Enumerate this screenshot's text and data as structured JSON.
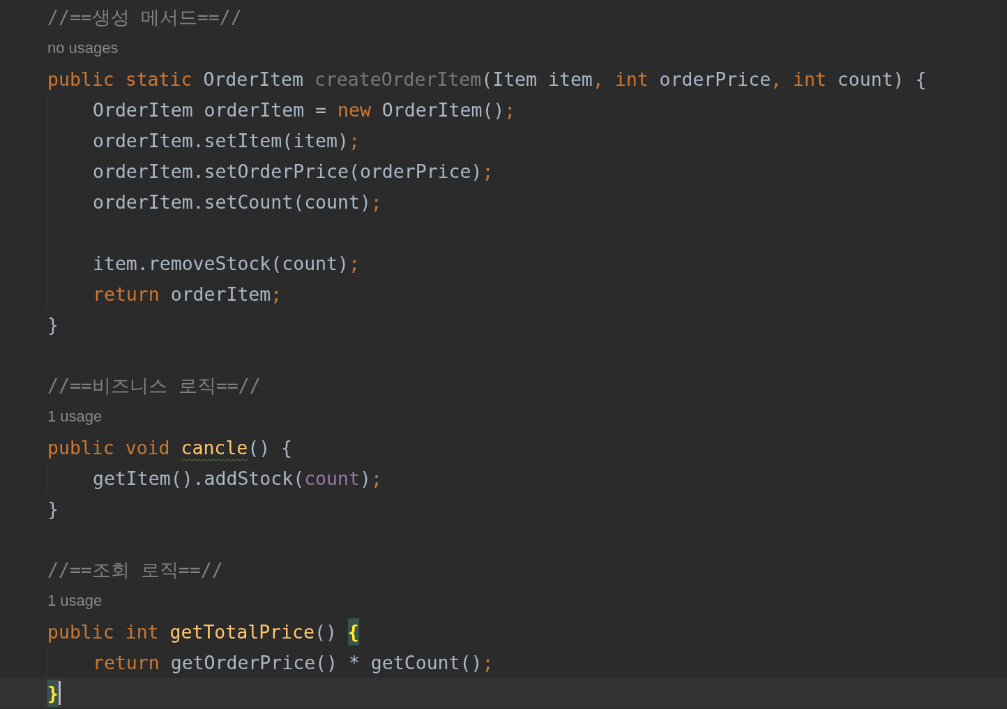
{
  "editor": {
    "lines": [
      {
        "kind": "comment",
        "text": "//==생성 메서드==//"
      },
      {
        "kind": "hint",
        "text": "no usages"
      },
      {
        "kind": "code",
        "current": false,
        "tokens": [
          {
            "text": "public ",
            "kind": "keyword"
          },
          {
            "text": "static ",
            "kind": "keyword"
          },
          {
            "text": "OrderItem ",
            "kind": "plain"
          },
          {
            "text": "createOrderItem",
            "kind": "unused"
          },
          {
            "text": "(Item item",
            "kind": "plain"
          },
          {
            "text": ", ",
            "kind": "punct"
          },
          {
            "text": "int ",
            "kind": "keyword"
          },
          {
            "text": "orderPrice",
            "kind": "plain"
          },
          {
            "text": ", ",
            "kind": "punct"
          },
          {
            "text": "int ",
            "kind": "keyword"
          },
          {
            "text": "count) {",
            "kind": "plain"
          }
        ],
        "children": [
          {
            "kind": "code",
            "current": false,
            "tokens": [
              {
                "text": "OrderItem orderItem = ",
                "kind": "plain"
              },
              {
                "text": "new ",
                "kind": "keyword"
              },
              {
                "text": "OrderItem()",
                "kind": "plain"
              },
              {
                "text": ";",
                "kind": "punct"
              }
            ]
          },
          {
            "kind": "code",
            "current": false,
            "tokens": [
              {
                "text": "orderItem.setItem(item)",
                "kind": "plain"
              },
              {
                "text": ";",
                "kind": "punct"
              }
            ]
          },
          {
            "kind": "code",
            "current": false,
            "tokens": [
              {
                "text": "orderItem.setOrderPrice(orderPrice)",
                "kind": "plain"
              },
              {
                "text": ";",
                "kind": "punct"
              }
            ]
          },
          {
            "kind": "code",
            "current": false,
            "tokens": [
              {
                "text": "orderItem.setCount(count)",
                "kind": "plain"
              },
              {
                "text": ";",
                "kind": "punct"
              }
            ]
          },
          {
            "kind": "blank"
          },
          {
            "kind": "code",
            "current": false,
            "tokens": [
              {
                "text": "item.removeStock(count)",
                "kind": "plain"
              },
              {
                "text": ";",
                "kind": "punct"
              }
            ]
          },
          {
            "kind": "code",
            "current": false,
            "tokens": [
              {
                "text": "return ",
                "kind": "keyword"
              },
              {
                "text": "orderItem",
                "kind": "plain"
              },
              {
                "text": ";",
                "kind": "punct"
              }
            ]
          }
        ]
      },
      {
        "kind": "code",
        "current": false,
        "tokens": [
          {
            "text": "}",
            "kind": "plain"
          }
        ]
      },
      {
        "kind": "blank"
      },
      {
        "kind": "comment",
        "text": "//==비즈니스 로직==//"
      },
      {
        "kind": "hint",
        "text": "1 usage"
      },
      {
        "kind": "code",
        "current": false,
        "tokens": [
          {
            "text": "public ",
            "kind": "keyword"
          },
          {
            "text": "void ",
            "kind": "keyword"
          },
          {
            "text": "cancle",
            "kind": "declaration",
            "typo": true
          },
          {
            "text": "() {",
            "kind": "plain"
          }
        ],
        "children": [
          {
            "kind": "code",
            "current": false,
            "tokens": [
              {
                "text": "getItem().addStock(",
                "kind": "plain"
              },
              {
                "text": "count",
                "kind": "field"
              },
              {
                "text": ")",
                "kind": "plain"
              },
              {
                "text": ";",
                "kind": "punct"
              }
            ]
          }
        ]
      },
      {
        "kind": "code",
        "current": false,
        "tokens": [
          {
            "text": "}",
            "kind": "plain"
          }
        ]
      },
      {
        "kind": "blank"
      },
      {
        "kind": "comment",
        "text": "//==조회 로직==//"
      },
      {
        "kind": "hint",
        "text": "1 usage"
      },
      {
        "kind": "code",
        "current": false,
        "tokens": [
          {
            "text": "public ",
            "kind": "keyword"
          },
          {
            "text": "int ",
            "kind": "keyword"
          },
          {
            "text": "getTotalPrice",
            "kind": "declaration",
            "typo": false
          },
          {
            "text": "() ",
            "kind": "plain"
          },
          {
            "text": "{",
            "kind": "plain",
            "matched": true
          }
        ],
        "children": [
          {
            "kind": "code",
            "current": false,
            "tokens": [
              {
                "text": "return ",
                "kind": "keyword"
              },
              {
                "text": "getOrderPrice() * getCount()",
                "kind": "plain"
              },
              {
                "text": ";",
                "kind": "punct"
              }
            ]
          }
        ]
      },
      {
        "kind": "code",
        "current": true,
        "tokens": [
          {
            "text": "}",
            "kind": "plain",
            "matched": true
          }
        ]
      }
    ]
  }
}
